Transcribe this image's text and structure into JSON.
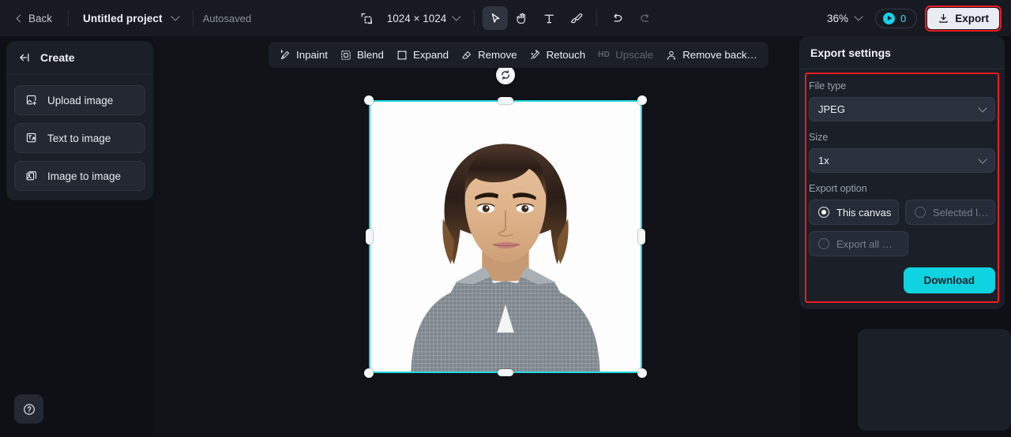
{
  "topbar": {
    "back_label": "Back",
    "project_name": "Untitled project",
    "autosave_label": "Autosaved",
    "canvas_size": "1024 × 1024",
    "zoom_level": "36%",
    "credits_count": "0",
    "export_label": "Export",
    "tools": [
      {
        "name": "resize-canvas-icon",
        "label": "Resize canvas",
        "active": false
      },
      {
        "name": "select-tool",
        "label": "Select",
        "active": true
      },
      {
        "name": "hand-tool",
        "label": "Hand",
        "active": false
      },
      {
        "name": "text-tool",
        "label": "Text",
        "active": false
      },
      {
        "name": "brush-tool",
        "label": "Brush",
        "active": false
      },
      {
        "name": "undo-button",
        "label": "Undo",
        "active": false
      },
      {
        "name": "redo-button",
        "label": "Redo",
        "active": false
      }
    ]
  },
  "sidebar": {
    "title": "Create",
    "items": [
      {
        "label": "Upload image",
        "icon": "upload-image-icon"
      },
      {
        "label": "Text to image",
        "icon": "text-to-image-icon"
      },
      {
        "label": "Image to image",
        "icon": "image-to-image-icon"
      }
    ]
  },
  "edit_toolbar": {
    "items": [
      {
        "label": "Inpaint",
        "icon": "inpaint-icon",
        "disabled": false
      },
      {
        "label": "Blend",
        "icon": "blend-icon",
        "disabled": false
      },
      {
        "label": "Expand",
        "icon": "expand-icon",
        "disabled": false
      },
      {
        "label": "Remove",
        "icon": "remove-icon",
        "disabled": false
      },
      {
        "label": "Retouch",
        "icon": "retouch-icon",
        "disabled": false
      },
      {
        "label": "Upscale",
        "badge": "HD",
        "icon": "upscale-icon",
        "disabled": true
      },
      {
        "label": "Remove back…",
        "icon": "remove-background-icon",
        "disabled": false
      }
    ]
  },
  "export_panel": {
    "title": "Export settings",
    "file_type_label": "File type",
    "file_type_value": "JPEG",
    "size_label": "Size",
    "size_value": "1x",
    "export_option_label": "Export option",
    "options": [
      {
        "label": "This canvas",
        "selected": true
      },
      {
        "label": "Selected l…",
        "selected": false
      },
      {
        "label": "Export all …",
        "selected": false
      }
    ],
    "download_label": "Download"
  },
  "canvas": {
    "image_description": "Portrait photo of a young man with shoulder-length dark hair wearing a grey textured shirt over a white t-shirt on a white background",
    "rotate_handle": "rotate-handle"
  },
  "colors": {
    "accent_cyan": "#0fd3e0",
    "selection_cyan": "#1fd5dd",
    "highlight_red": "#ef1b24",
    "panel_bg": "#1b1f27",
    "topbar_bg": "#171a21",
    "canvas_bg": "#101217"
  },
  "help": {
    "label": "Help"
  }
}
